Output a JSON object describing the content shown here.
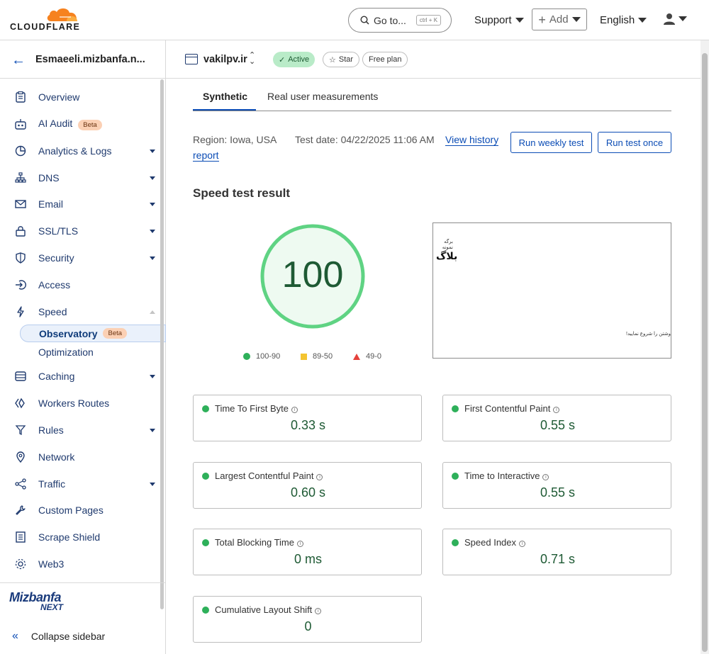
{
  "topbar": {
    "brand": "CLOUDFLARE",
    "search_text": "Go to...",
    "search_shortcut": "ctrl + K",
    "support_label": "Support",
    "add_label": "Add",
    "language_label": "English"
  },
  "sidebar": {
    "account_name": "Esmaeeli.mizbanfa.n...",
    "items": [
      {
        "label": "Overview",
        "icon": "clipboard-icon"
      },
      {
        "label": "AI Audit",
        "icon": "robot-icon",
        "badge": "Beta"
      },
      {
        "label": "Analytics & Logs",
        "icon": "pie-chart-icon"
      },
      {
        "label": "DNS",
        "icon": "network-tree-icon"
      },
      {
        "label": "Email",
        "icon": "mail-icon"
      },
      {
        "label": "SSL/TLS",
        "icon": "lock-icon"
      },
      {
        "label": "Security",
        "icon": "shield-icon"
      },
      {
        "label": "Access",
        "icon": "login-icon"
      },
      {
        "label": "Speed",
        "icon": "lightning-icon"
      },
      {
        "label": "Caching",
        "icon": "server-icon"
      },
      {
        "label": "Workers Routes",
        "icon": "workers-icon"
      },
      {
        "label": "Rules",
        "icon": "filter-icon"
      },
      {
        "label": "Network",
        "icon": "location-pin-icon"
      },
      {
        "label": "Traffic",
        "icon": "share-nodes-icon"
      },
      {
        "label": "Custom Pages",
        "icon": "wrench-icon"
      },
      {
        "label": "Scrape Shield",
        "icon": "document-icon"
      },
      {
        "label": "Web3",
        "icon": "web3-icon"
      }
    ],
    "sub_items": [
      {
        "label": "Observatory",
        "badge": "Beta"
      },
      {
        "label": "Optimization"
      }
    ],
    "brand_top": "Mizbanfa",
    "brand_bottom": "NEXT",
    "collapse_label": "Collapse sidebar"
  },
  "zone": {
    "name": "vakilpv.ir",
    "status": "Active",
    "star_label": "Star",
    "plan_label": "Free plan"
  },
  "tabs": [
    "Synthetic",
    "Real user measurements"
  ],
  "test": {
    "region": "Region: Iowa, USA",
    "date": "Test date: 04/22/2025 11:06 AM",
    "view_history_line1": "View history",
    "view_history_line2": "report",
    "run_weekly": "Run weekly test",
    "run_once": "Run test once"
  },
  "result": {
    "title": "Speed test result",
    "score": "100",
    "score_fraction": 1.0,
    "legend": [
      {
        "label": "100-90",
        "color": "#2eb05a"
      },
      {
        "label": "89-50",
        "color": "#f4c430"
      },
      {
        "label": "49-0",
        "color": "#e5413b"
      }
    ],
    "preview_line1": "برگه نمونه",
    "preview_heading": "بلاگ",
    "preview_line2": "وشتن را شروع نمایید!"
  },
  "metrics": [
    {
      "label": "Time To First Byte",
      "value": "0.33 s"
    },
    {
      "label": "First Contentful Paint",
      "value": "0.55 s"
    },
    {
      "label": "Largest Contentful Paint",
      "value": "0.60 s"
    },
    {
      "label": "Time to Interactive",
      "value": "0.55 s"
    },
    {
      "label": "Total Blocking Time",
      "value": "0 ms"
    },
    {
      "label": "Speed Index",
      "value": "0.71 s"
    },
    {
      "label": "Cumulative Layout Shift",
      "value": "0"
    }
  ],
  "colors": {
    "accent": "#0b4cb5",
    "good": "#2eb05a",
    "score_ring": "#5fd383",
    "score_fill": "#eefaf1",
    "score_text": "#1e5a34"
  }
}
